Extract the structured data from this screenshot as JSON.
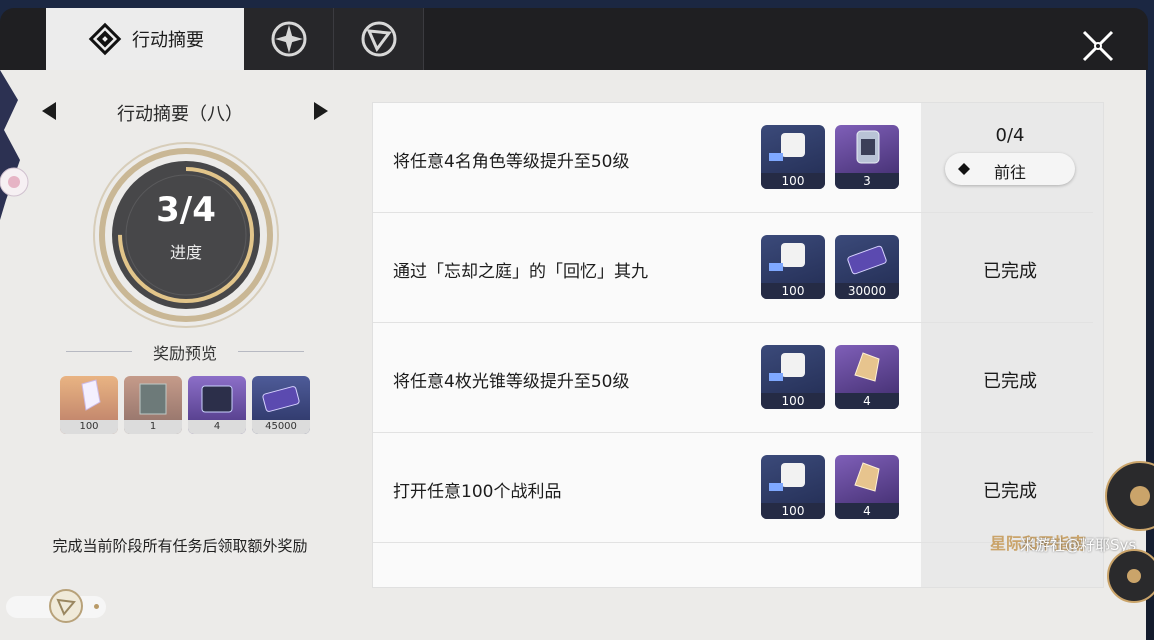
{
  "tabs": [
    {
      "label": "行动摘要",
      "icon": "summary-icon"
    },
    {
      "label": "",
      "icon": "star-rail-icon"
    },
    {
      "label": "",
      "icon": "compass-icon"
    }
  ],
  "stage": {
    "title": "行动摘要（八）",
    "progress_value": "3/4",
    "progress_label": "进度",
    "progress_fraction": 0.75
  },
  "reward_preview": {
    "title": "奖励预览",
    "items": [
      {
        "icon": "stellar-jade-icon",
        "count": "100"
      },
      {
        "icon": "material-chip-icon",
        "count": "1"
      },
      {
        "icon": "exp-book-icon",
        "count": "4"
      },
      {
        "icon": "credit-icon",
        "count": "45000"
      }
    ],
    "footnote": "完成当前阶段所有任务后领取额外奖励"
  },
  "tasks": [
    {
      "text": "将任意4名角色等级提升至50级",
      "rewards": [
        {
          "icon": "trailblaze-exp-icon",
          "count": "100"
        },
        {
          "icon": "fuel-icon",
          "count": "3"
        }
      ],
      "progress": "0/4",
      "action": "前往",
      "status": ""
    },
    {
      "text": "通过「忘却之庭」的「回忆」其九",
      "rewards": [
        {
          "icon": "trailblaze-exp-icon",
          "count": "100"
        },
        {
          "icon": "credit-icon",
          "count": "30000"
        }
      ],
      "progress": "",
      "action": "",
      "status": "已完成"
    },
    {
      "text": "将任意4枚光锥等级提升至50级",
      "rewards": [
        {
          "icon": "trailblaze-exp-icon",
          "count": "100"
        },
        {
          "icon": "refine-aether-icon",
          "count": "4"
        }
      ],
      "progress": "",
      "action": "",
      "status": "已完成"
    },
    {
      "text": "打开任意100个战利品",
      "rewards": [
        {
          "icon": "trailblaze-exp-icon",
          "count": "100"
        },
        {
          "icon": "refine-aether-icon",
          "count": "4"
        }
      ],
      "progress": "",
      "action": "",
      "status": "已完成"
    }
  ],
  "brand": "星际和平指南",
  "watermark": "米游社@籽耶Sys",
  "colors": {
    "accent_gold": "#caa46a",
    "dial_dark": "#4a4a4c",
    "tab_dark": "#1f1f22"
  }
}
